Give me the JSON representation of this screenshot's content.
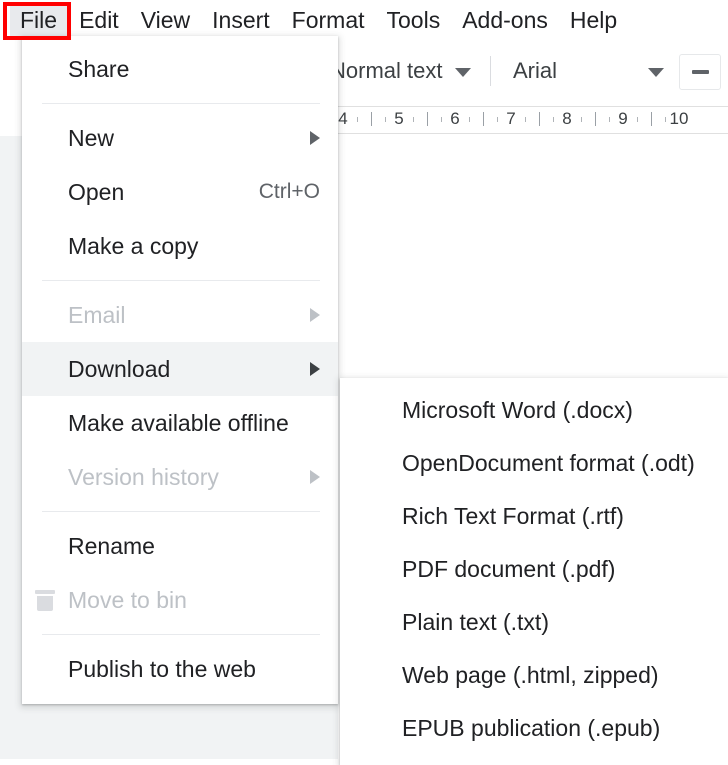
{
  "menubar": {
    "items": [
      {
        "label": "File",
        "active": true
      },
      {
        "label": "Edit",
        "active": false
      },
      {
        "label": "View",
        "active": false
      },
      {
        "label": "Insert",
        "active": false
      },
      {
        "label": "Format",
        "active": false
      },
      {
        "label": "Tools",
        "active": false
      },
      {
        "label": "Add-ons",
        "active": false
      },
      {
        "label": "Help",
        "active": false
      }
    ]
  },
  "toolbar": {
    "style_value": "Normal text",
    "font_value": "Arial",
    "decrease_font_label": "−",
    "style_caret_icon": "chevron-down-icon",
    "font_caret_icon": "chevron-down-icon"
  },
  "ruler": {
    "numbers": [
      "4",
      "5",
      "6",
      "7",
      "8",
      "9",
      "10"
    ]
  },
  "file_menu": {
    "items": [
      {
        "label": "Share",
        "shortcut": "",
        "arrow": false,
        "disabled": false,
        "highlight": false,
        "icon": "",
        "sep_after": true
      },
      {
        "label": "New",
        "shortcut": "",
        "arrow": true,
        "disabled": false,
        "highlight": false,
        "icon": "",
        "sep_after": false
      },
      {
        "label": "Open",
        "shortcut": "Ctrl+O",
        "arrow": false,
        "disabled": false,
        "highlight": false,
        "icon": "",
        "sep_after": false
      },
      {
        "label": "Make a copy",
        "shortcut": "",
        "arrow": false,
        "disabled": false,
        "highlight": false,
        "icon": "",
        "sep_after": true
      },
      {
        "label": "Email",
        "shortcut": "",
        "arrow": true,
        "disabled": true,
        "highlight": false,
        "icon": "",
        "sep_after": false
      },
      {
        "label": "Download",
        "shortcut": "",
        "arrow": true,
        "disabled": false,
        "highlight": true,
        "icon": "",
        "sep_after": false
      },
      {
        "label": "Make available offline",
        "shortcut": "",
        "arrow": false,
        "disabled": false,
        "highlight": false,
        "icon": "",
        "sep_after": false
      },
      {
        "label": "Version history",
        "shortcut": "",
        "arrow": true,
        "disabled": true,
        "highlight": false,
        "icon": "",
        "sep_after": true
      },
      {
        "label": "Rename",
        "shortcut": "",
        "arrow": false,
        "disabled": false,
        "highlight": false,
        "icon": "",
        "sep_after": false
      },
      {
        "label": "Move to bin",
        "shortcut": "",
        "arrow": false,
        "disabled": true,
        "highlight": false,
        "icon": "trash-icon",
        "sep_after": true
      },
      {
        "label": "Publish to the web",
        "shortcut": "",
        "arrow": false,
        "disabled": false,
        "highlight": false,
        "icon": "",
        "sep_after": false
      }
    ]
  },
  "download_submenu": {
    "items": [
      {
        "label": "Microsoft Word (.docx)"
      },
      {
        "label": "OpenDocument format (.odt)"
      },
      {
        "label": "Rich Text Format (.rtf)"
      },
      {
        "label": "PDF document (.pdf)"
      },
      {
        "label": "Plain text (.txt)"
      },
      {
        "label": "Web page (.html, zipped)"
      },
      {
        "label": "EPUB publication (.epub)"
      }
    ]
  },
  "annotation": {
    "target": "File",
    "color": "#ff0000"
  }
}
